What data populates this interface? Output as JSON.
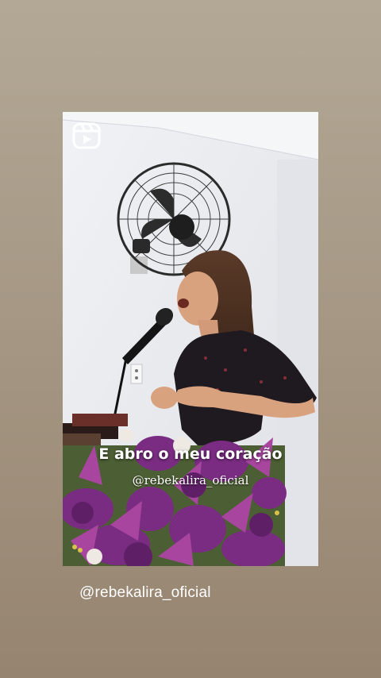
{
  "story": {
    "reels_icon": "reels-icon",
    "video_caption": "E abro o meu coração",
    "video_watermark": "@rebekalira_oficial",
    "mention_sticker": "@rebekalira_oficial"
  },
  "colors": {
    "background_top": "#b3a896",
    "background_bottom": "#968470",
    "caption_text": "#ffffff",
    "flowers_purple": "#8e2e8f"
  }
}
